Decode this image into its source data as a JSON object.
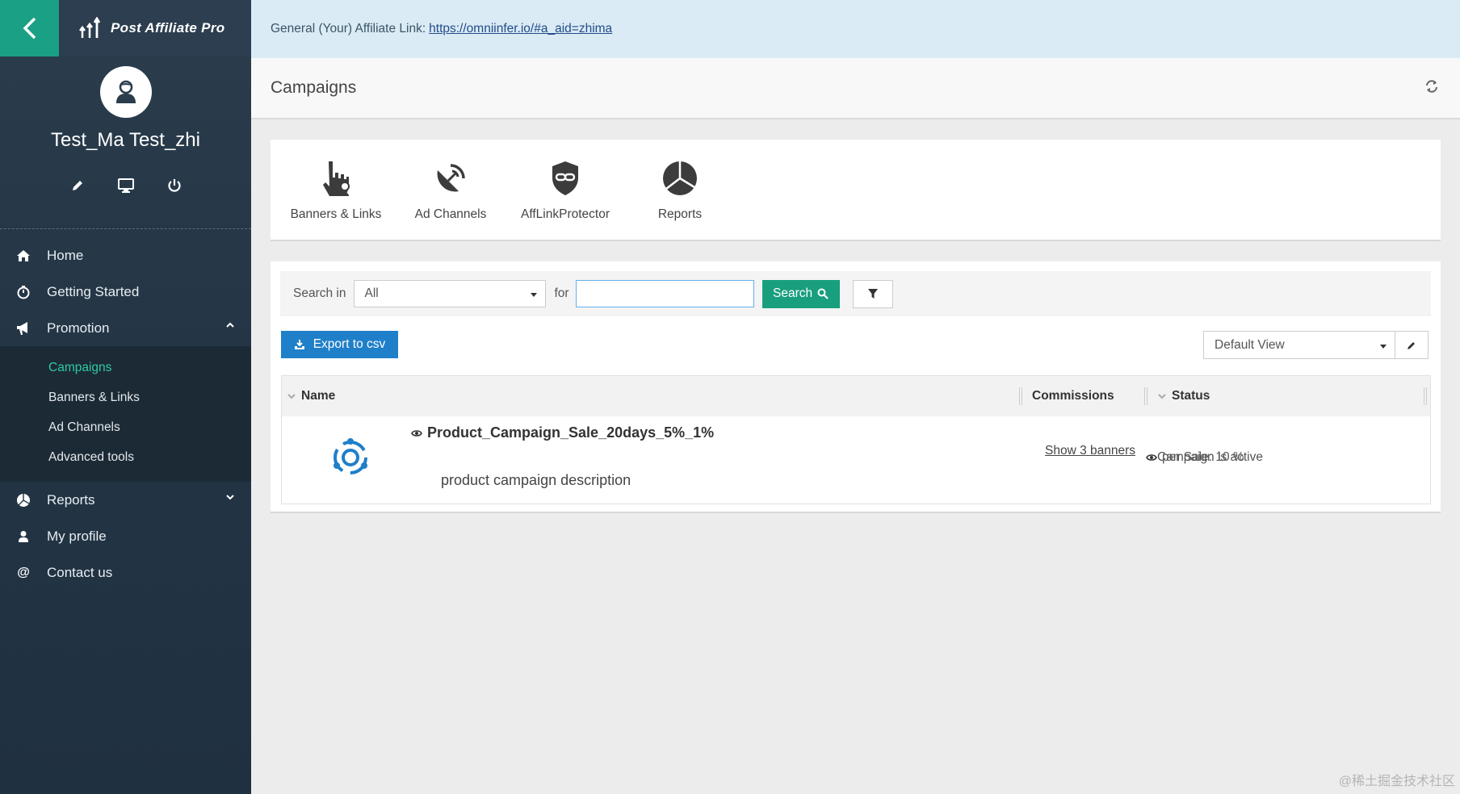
{
  "app": {
    "brand": "Post Affiliate Pro"
  },
  "user": {
    "name": "Test_Ma Test_zhi"
  },
  "sidebar": {
    "items": [
      {
        "label": "Home",
        "icon": "home-icon"
      },
      {
        "label": "Getting Started",
        "icon": "stopwatch-icon"
      },
      {
        "label": "Promotion",
        "icon": "bullhorn-icon"
      },
      {
        "label": "Reports",
        "icon": "pie-chart-icon"
      },
      {
        "label": "My profile",
        "icon": "user-icon"
      },
      {
        "label": "Contact us",
        "icon": "at-icon"
      }
    ],
    "promotion_sub": [
      "Campaigns",
      "Banners & Links",
      "Ad Channels",
      "Advanced tools"
    ]
  },
  "topbar": {
    "prefix": "General (Your) Affiliate Link:",
    "link": "https://omniinfer.io/#a_aid=zhima"
  },
  "page": {
    "title": "Campaigns"
  },
  "tiles": [
    "Banners & Links",
    "Ad Channels",
    "AffLinkProtector",
    "Reports"
  ],
  "search": {
    "label": "Search in",
    "scope": "All",
    "for_label": "for",
    "value": "",
    "button": "Search"
  },
  "toolbar": {
    "export_label": "Export to csv",
    "view": "Default View"
  },
  "grid": {
    "columns": [
      "Name",
      "Commissions",
      "Status"
    ],
    "rows": [
      {
        "name": "Product_Campaign_Sale_20days_5%_1%",
        "description": "product campaign description",
        "banners_link": "Show 3 banners",
        "commission": "per Sale: 10 %",
        "status": "Campaign is active"
      }
    ]
  },
  "watermark": "@稀土掘金技术社区",
  "colors": {
    "accent": "#1aa085",
    "sidebar": "#243646",
    "primary": "#1f7fc9",
    "active_sub": "#2ecb9f"
  }
}
